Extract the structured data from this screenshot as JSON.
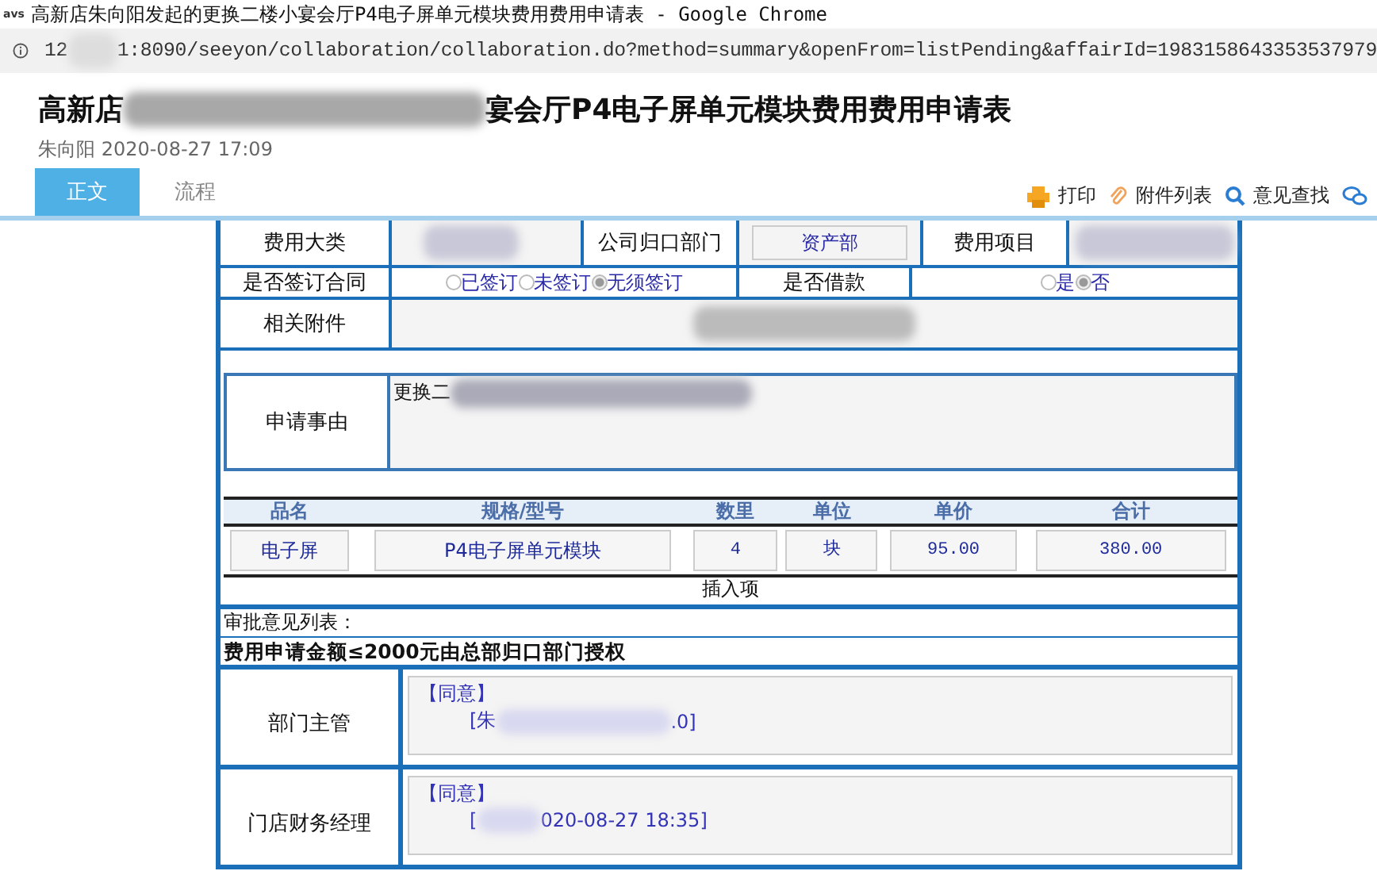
{
  "browser": {
    "favicon": "avs",
    "title": "高新店朱向阳发起的更换二楼小宴会厅P4电子屏单元模块费用费用申请表 - Google Chrome",
    "url_start": "12",
    "url_rest": "1:8090/seeyon/collaboration/collaboration.do?method=summary&openFrom=listPending&affairId=1983158643353537979"
  },
  "header": {
    "title_start": "高新店",
    "title_end": "宴会厅P4电子屏单元模块费用费用申请表",
    "author_date": "朱向阳 2020-08-27 17:09"
  },
  "tabs": [
    {
      "label": "正文",
      "selected": true
    },
    {
      "label": "流程",
      "selected": false
    }
  ],
  "toolbar": [
    {
      "kind": "print",
      "label": "打印"
    },
    {
      "kind": "attach",
      "label": "附件列表"
    },
    {
      "kind": "search",
      "label": "意见查找"
    },
    {
      "kind": "chat"
    }
  ],
  "form": {
    "category_label": "费用大类",
    "dept_label": "公司归口部门",
    "dept_value": "资产部",
    "item_label": "费用项目",
    "contract_label": "是否签订合同",
    "contract_options": [
      {
        "label": "已签订",
        "selected": false
      },
      {
        "label": "未签订",
        "selected": false
      },
      {
        "label": "无须签订",
        "selected": true
      }
    ],
    "loan_label": "是否借款",
    "loan_options": [
      {
        "label": "是",
        "selected": false
      },
      {
        "label": "否",
        "selected": true
      }
    ],
    "attachment_label": "相关附件",
    "reason_label": "申请事由",
    "reason_value": "更换二",
    "columns": [
      "品名",
      "规格/型号",
      "数里",
      "单位",
      "单价",
      "合计"
    ],
    "rows": [
      [
        "电子屏",
        "P4电子屏单元模块",
        "4",
        "块",
        "95.00",
        "380.00"
      ]
    ],
    "insert_label": "插入项"
  },
  "approvals": {
    "title": "审批意见列表：",
    "rule": "费用申请金额≤2000元由总部归口部门授权",
    "entries": [
      {
        "role": "部门主管",
        "verdict": "【同意】",
        "sign_start": "[朱",
        "sign_end": ".0]"
      },
      {
        "role": "门店财务经理",
        "verdict": "【同意】",
        "sign_start": "[",
        "sign_end": "020-08-27 18:35]"
      }
    ]
  }
}
